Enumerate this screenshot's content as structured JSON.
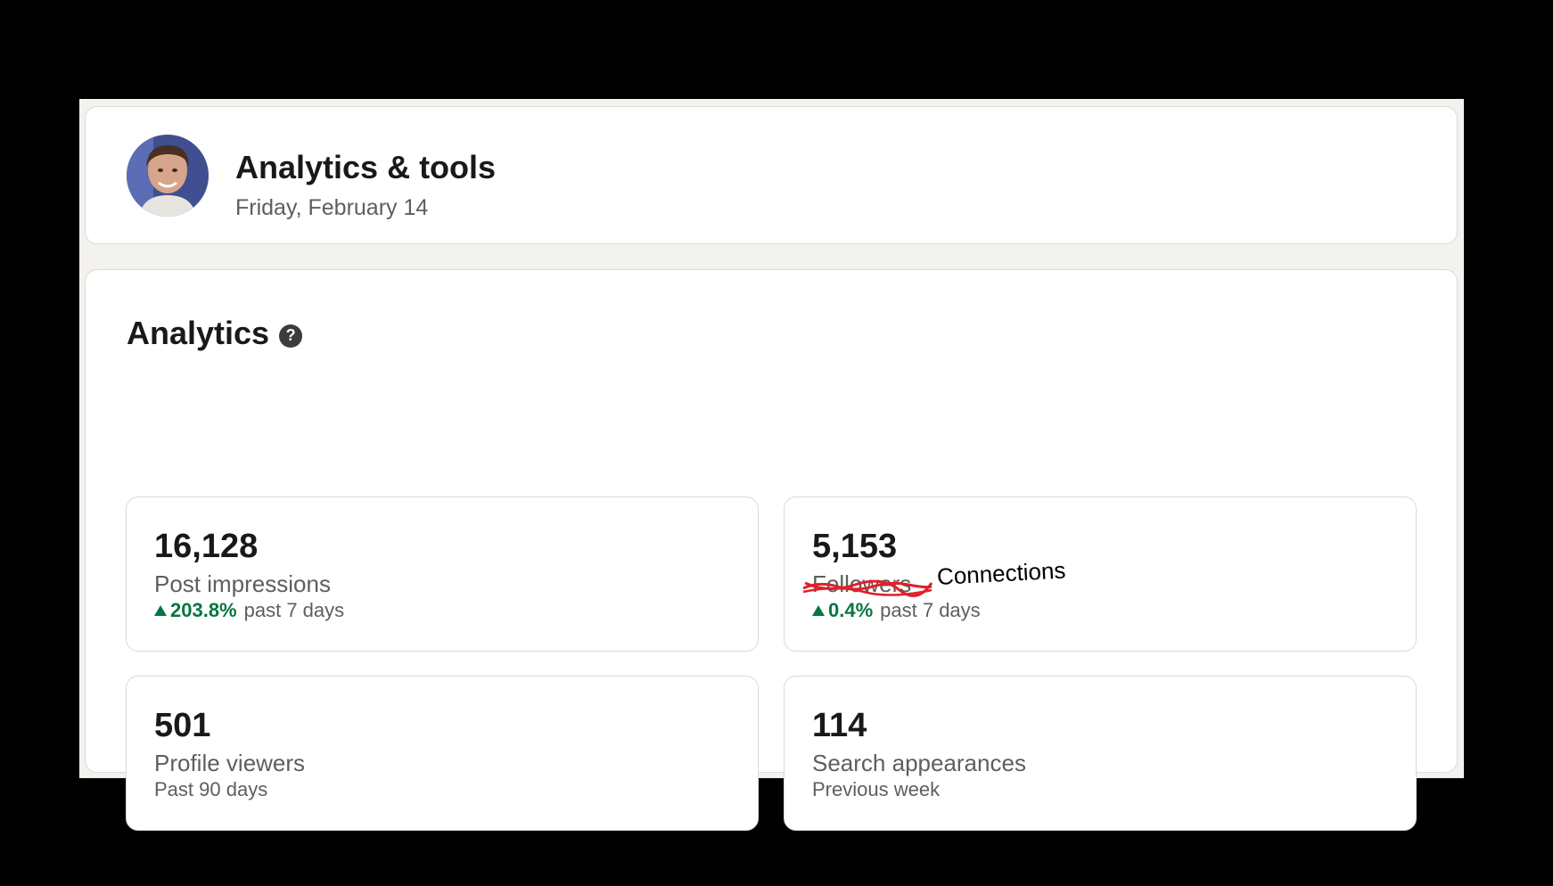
{
  "header": {
    "title": "Analytics & tools",
    "date": "Friday, February 14"
  },
  "analytics": {
    "title": "Analytics",
    "help_icon": "question-mark-icon",
    "metrics": [
      {
        "value": "16,128",
        "label": "Post impressions",
        "trend": "203.8%",
        "period": "past 7 days"
      },
      {
        "value": "5,153",
        "label": "Followers",
        "annotation": "Connections",
        "trend": "0.4%",
        "period": "past 7 days"
      },
      {
        "value": "501",
        "label": "Profile viewers",
        "period": "Past 90 days"
      },
      {
        "value": "114",
        "label": "Search appearances",
        "period": "Previous week"
      }
    ]
  },
  "colors": {
    "background": "#f4f2ee",
    "card": "#ffffff",
    "positive": "#057642",
    "text_primary": "#191919",
    "text_secondary": "#5e5e5e",
    "annotation_strike": "#e0202a"
  }
}
